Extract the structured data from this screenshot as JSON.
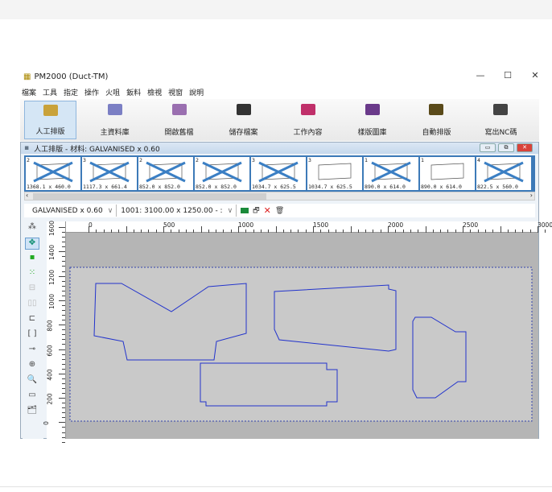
{
  "window": {
    "title": "PM2000 (Duct-TM)",
    "minimize": "—",
    "maximize": "☐",
    "close": "✕"
  },
  "menu": [
    "檔案",
    "工具",
    "指定",
    "操作",
    "火咀",
    "鈑料",
    "檢視",
    "視窗",
    "說明"
  ],
  "toolbar": [
    {
      "label": "人工排版",
      "icon": "manual-nesting-icon",
      "color": "#c9a23a",
      "active": true
    },
    {
      "label": "主資料庫",
      "icon": "database-icon",
      "color": "#7b7fc4"
    },
    {
      "label": "開啟舊檔",
      "icon": "open-file-icon",
      "color": "#9a6fb0"
    },
    {
      "label": "儲存檔案",
      "icon": "save-icon",
      "color": "#333333"
    },
    {
      "label": "工作內容",
      "icon": "job-content-icon",
      "color": "#c0306a"
    },
    {
      "label": "樣版圖庫",
      "icon": "template-library-icon",
      "color": "#6a3a8a"
    },
    {
      "label": "自動排版",
      "icon": "auto-nesting-icon",
      "color": "#5a4a1a"
    },
    {
      "label": "寫出NC碼",
      "icon": "nc-output-icon",
      "color": "#444444"
    }
  ],
  "child": {
    "title": "人工排版  - 材料: GALVANISED x 0.60"
  },
  "thumbnails": [
    {
      "count": "2",
      "size": "1368.1 x 460.0",
      "crossed": true
    },
    {
      "count": "3",
      "size": "1117.3 x 661.4",
      "crossed": true
    },
    {
      "count": "2",
      "size": "852.0 x 852.0",
      "crossed": true
    },
    {
      "count": "2",
      "size": "852.0 x 852.0",
      "crossed": true
    },
    {
      "count": "3",
      "size": "1034.7 x 625.5",
      "crossed": true
    },
    {
      "count": "3",
      "size": "1034.7 x 625.5",
      "crossed": false
    },
    {
      "count": "1",
      "size": "890.0 x 614.0",
      "crossed": true
    },
    {
      "count": "1",
      "size": "890.0 x 614.0",
      "crossed": false
    },
    {
      "count": "4",
      "size": "822.5 x 560.0",
      "crossed": true
    }
  ],
  "combos": {
    "material": "GALVANISED x 0.60",
    "sheet": "1001: 3100.00 x 1250.00 - :"
  },
  "ruler": {
    "x": [
      "0",
      "500",
      "1000",
      "1500",
      "2000",
      "2500",
      "3000"
    ],
    "y": [
      "1600",
      "1400",
      "1200",
      "1000",
      "800",
      "600",
      "400",
      "200",
      "0"
    ]
  },
  "colors": {
    "part_outline": "#2233cc",
    "sheet_border": "#3344aa",
    "thumb_cross": "#3b7fc4"
  }
}
